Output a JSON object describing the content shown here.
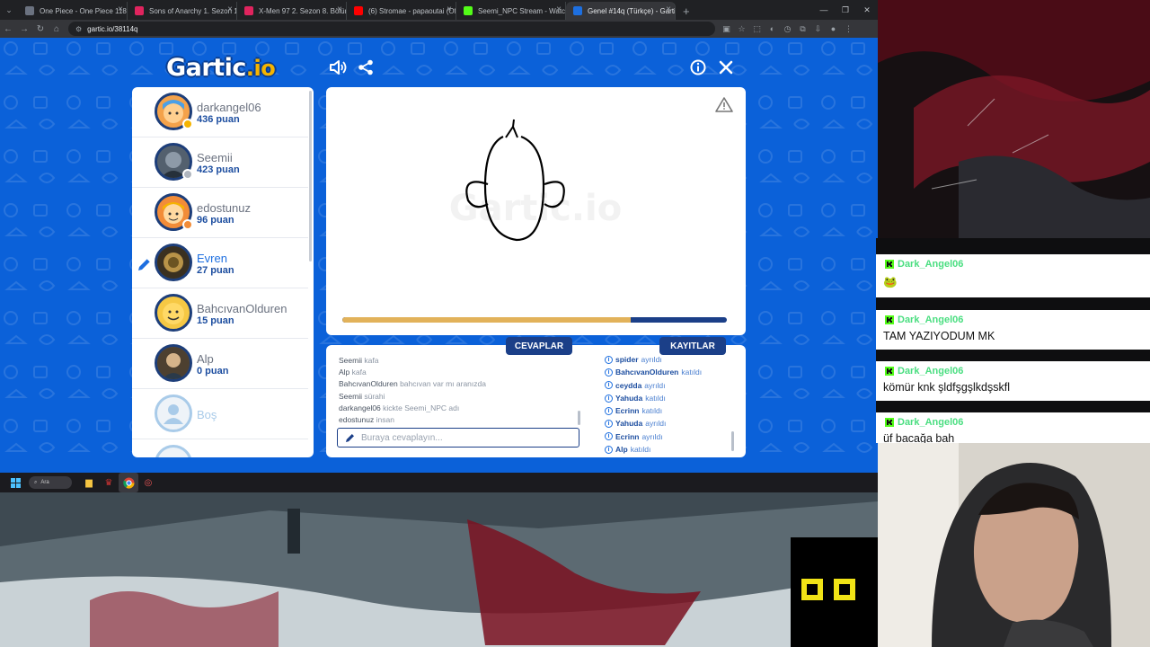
{
  "browser": {
    "tabs": [
      {
        "title": "One Piece - One Piece 1189 - Tü",
        "active": false
      },
      {
        "title": "Sons of Anarchy 1. Sezon 1. Bölü",
        "active": false
      },
      {
        "title": "X-Men 97 2. Sezon 8. Bölüm izle",
        "active": false
      },
      {
        "title": "(6) Stromae - papaoutai (Offic",
        "active": false
      },
      {
        "title": "Seemi_NPC Stream - Watch Live",
        "active": false
      },
      {
        "title": "Genel #14q (Türkçe) - Gartic.io",
        "active": true
      }
    ],
    "url": "gartic.io/38114q"
  },
  "game": {
    "logo_main": "Gartic",
    "logo_suffix": ".io",
    "players": [
      {
        "name": "darkangel06",
        "points": "436 puan"
      },
      {
        "name": "Seemii",
        "points": "423 puan"
      },
      {
        "name": "edostunuz",
        "points": "96 puan"
      },
      {
        "name": "Evren",
        "points": "27 puan"
      },
      {
        "name": "BahcıvanOlduren",
        "points": "15 puan"
      },
      {
        "name": "Alp",
        "points": "0 puan"
      },
      {
        "name": "Boş",
        "points": ""
      }
    ],
    "draw_progress": 0.75,
    "answers_label": "CEVAPLAR",
    "logs_label": "KAYITLAR",
    "answers": [
      {
        "user": "Seemii",
        "text": "kafa"
      },
      {
        "user": "Alp",
        "text": "kafa"
      },
      {
        "user": "BahcıvanOlduren",
        "text": "bahcıvan var mı aranızda"
      },
      {
        "user": "Seemii",
        "text": "sürahi"
      },
      {
        "user": "darkangel06",
        "text": "kickte Seemi_NPC adı"
      },
      {
        "user": "edostunuz",
        "text": "insan"
      }
    ],
    "answer_placeholder": "Buraya cevaplayın...",
    "logs": [
      {
        "user": "spider",
        "action": "ayrıldı"
      },
      {
        "user": "BahcıvanOlduren",
        "action": "katıldı"
      },
      {
        "user": "ceydda",
        "action": "ayrıldı"
      },
      {
        "user": "Yahuda",
        "action": "katıldı"
      },
      {
        "user": "Ecrinn",
        "action": "katıldı"
      },
      {
        "user": "Yahuda",
        "action": "ayrıldı"
      },
      {
        "user": "Ecrinn",
        "action": "ayrıldı"
      },
      {
        "user": "Alp",
        "action": "katıldı"
      }
    ]
  },
  "taskbar": {
    "search_label": "Ara"
  },
  "stream_chat": {
    "messages": [
      {
        "user": "Dark_Angel06",
        "text": "🐸"
      },
      {
        "user": "Dark_Angel06",
        "text": "TAM YAZIYODUM MK"
      },
      {
        "user": "Dark_Angel06",
        "text": "kömür knk şldfşgşlkdşskfl"
      },
      {
        "user": "Dark_Angel06",
        "text": "üf bacağa bah"
      }
    ]
  },
  "colors": {
    "game_blue": "#0b61d9",
    "navy": "#1b3f88",
    "progress_fill": "#e2b25a",
    "chat_user": "#4ade80"
  }
}
